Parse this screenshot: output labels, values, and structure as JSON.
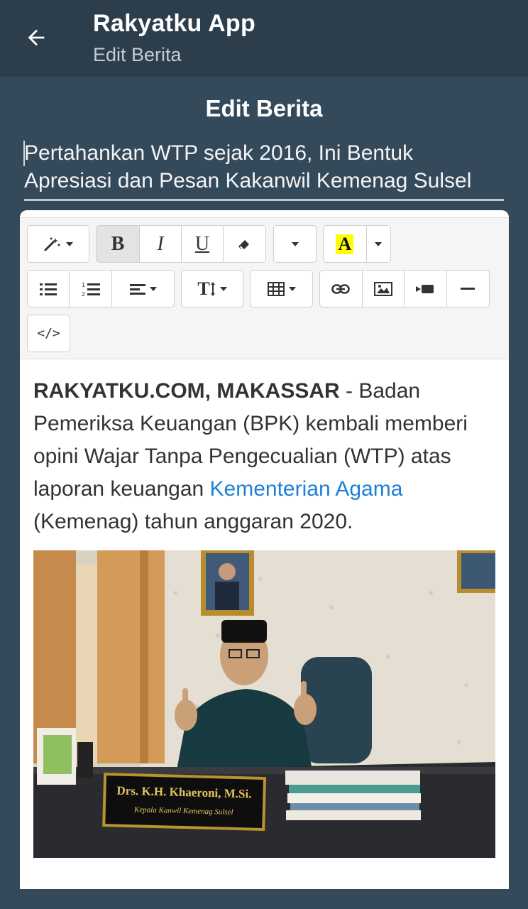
{
  "appbar": {
    "back_icon": "arrow-left-icon",
    "title": "Rakyatku App",
    "subtitle": "Edit Berita"
  },
  "page": {
    "title": "Edit Berita"
  },
  "article": {
    "headline": "Pertahankan WTP sejak 2016, Ini Bentuk Apresiasi dan Pesan Kakanwil Kemenag Sulsel",
    "lead": "RAKYATKU.COM, MAKASSAR",
    "text_before_link": " - Badan Pemeriksa Keuangan (BPK) kembali memberi opini Wajar Tanpa Pengecualian (WTP) atas laporan keuangan ",
    "link_text": "Kementerian Agama",
    "text_after_link": " (Kemenag) tahun anggaran 2020.",
    "image": {
      "nameplate_line1": "Drs. K.H. Khaeroni, M.Si.",
      "nameplate_line2": "Kepala Kanwil Kemenag Sulsel"
    }
  },
  "toolbar": {
    "bold_label": "B",
    "italic_label": "I",
    "underline_label": "U",
    "font_color_label": "A",
    "font_size_label": "T",
    "highlight_color": "#ffff00",
    "code_label": "</>"
  },
  "colors": {
    "background": "#34495a",
    "appbar": "#2c3d4c",
    "link": "#1e7fd8"
  }
}
